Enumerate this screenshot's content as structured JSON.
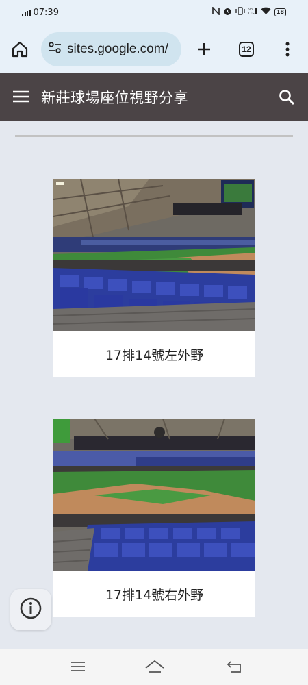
{
  "status_bar": {
    "time": "07:39",
    "battery": "18",
    "icons": [
      "signal-icon",
      "nfc-icon",
      "alarm-icon",
      "vibrate-icon",
      "volte-icon",
      "wifi-icon",
      "battery-icon"
    ]
  },
  "browser": {
    "url": "sites.google.com/",
    "tab_count": "12",
    "icons": [
      "home-icon",
      "site-settings-icon",
      "new-tab-icon",
      "tabs-icon",
      "more-menu-icon"
    ]
  },
  "site": {
    "title": "新莊球場座位視野分享",
    "icons": [
      "menu-icon",
      "search-icon"
    ]
  },
  "cards": [
    {
      "caption": "17排14號左外野"
    },
    {
      "caption": "17排14號右外野"
    }
  ],
  "colors": {
    "browser_bg": "#e8f1f9",
    "url_pill": "#d0e4ef",
    "header_bg": "#4b4446",
    "page_bg": "#e4e8ef",
    "seat_blue": "#2c3d9e",
    "field_green": "#3f8a3a"
  },
  "nav_bar": {
    "icons": [
      "recents-icon",
      "home-nav-icon",
      "back-icon"
    ]
  }
}
